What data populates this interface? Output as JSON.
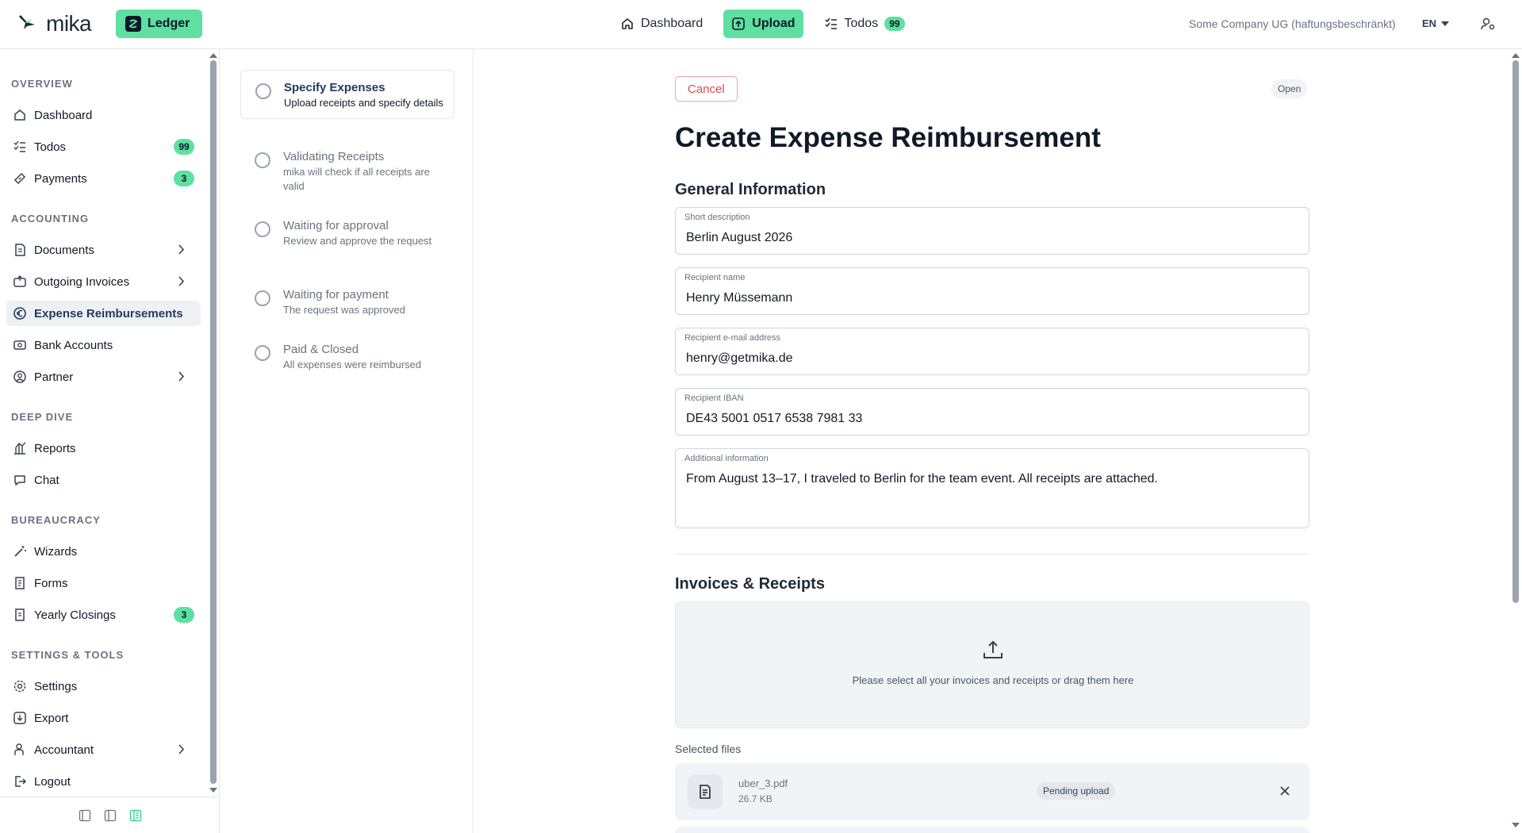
{
  "topbar": {
    "logo_text": "mika",
    "ledger_label": "Ledger",
    "nav": {
      "dashboard": "Dashboard",
      "upload": "Upload",
      "todos": "Todos",
      "todos_count": "99"
    },
    "company": "Some Company UG (haftungsbeschränkt)",
    "language": "EN"
  },
  "sidebar": {
    "sections": {
      "overview": "OVERVIEW",
      "accounting": "ACCOUNTING",
      "deep_dive": "DEEP DIVE",
      "bureaucracy": "BUREAUCRACY",
      "settings_tools": "SETTINGS & TOOLS"
    },
    "items": {
      "dashboard": "Dashboard",
      "todos": "Todos",
      "todos_badge": "99",
      "payments": "Payments",
      "payments_badge": "3",
      "documents": "Documents",
      "outgoing_invoices": "Outgoing Invoices",
      "expense_reimbursements": "Expense Reimbursements",
      "bank_accounts": "Bank Accounts",
      "partner": "Partner",
      "reports": "Reports",
      "chat": "Chat",
      "wizards": "Wizards",
      "forms": "Forms",
      "yearly_closings": "Yearly Closings",
      "yearly_closings_badge": "3",
      "settings": "Settings",
      "export": "Export",
      "accountant": "Accountant",
      "logout": "Logout"
    }
  },
  "steps": [
    {
      "title": "Specify Expenses",
      "desc": "Upload receipts and specify details"
    },
    {
      "title": "Validating Receipts",
      "desc": "mika will check if all receipts are valid"
    },
    {
      "title": "Waiting for approval",
      "desc": "Review and approve the request"
    },
    {
      "title": "Waiting for payment",
      "desc": "The request was approved"
    },
    {
      "title": "Paid & Closed",
      "desc": "All expenses were reimbursed"
    }
  ],
  "main": {
    "cancel_label": "Cancel",
    "status": "Open",
    "title": "Create Expense Reimbursement",
    "general_title": "General Information",
    "fields": {
      "short_description": {
        "label": "Short description",
        "value": "Berlin August 2026"
      },
      "recipient_name": {
        "label": "Recipient name",
        "value": "Henry Müssemann"
      },
      "recipient_email": {
        "label": "Recipient e-mail address",
        "value": "henry@getmika.de"
      },
      "recipient_iban": {
        "label": "Recipient IBAN",
        "value": "DE43 5001 0517 6538 7981 33"
      },
      "additional_info": {
        "label": "Additional information",
        "value": "From August 13–17, I traveled to Berlin for the team event. All receipts are attached."
      }
    },
    "invoices_title": "Invoices & Receipts",
    "dropzone_text": "Please select all your invoices and receipts or drag them here",
    "selected_files_label": "Selected files",
    "files": [
      {
        "name": "uber_3.pdf",
        "size": "26.7 KB",
        "status": "Pending upload"
      }
    ]
  },
  "colors": {
    "accent": "#5de0a0",
    "danger": "#dc4b4b",
    "active_nav_text": "#1e3a5f"
  }
}
